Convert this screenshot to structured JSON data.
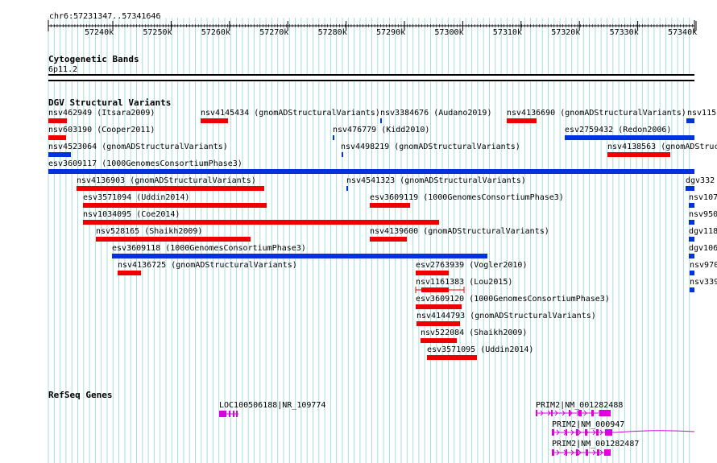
{
  "header": {
    "coords": "chr6:57231347..57341646"
  },
  "ruler": {
    "ticks": [
      "57240k",
      "57250k",
      "57260k",
      "57270k",
      "57280k",
      "57290k",
      "57300k",
      "57310k",
      "57320k",
      "57330k",
      "57340k"
    ]
  },
  "tracks": {
    "cyto": {
      "title": "Cytogenetic Bands",
      "band": "6p11.2"
    },
    "dgv": {
      "title": "DGV Structural Variants",
      "labels": [
        "nsv462949 (Itsara2009)",
        "nsv4145434 (gnomADStructuralVariants)",
        "nsv3384676 (Audano2019)",
        "nsv4136690 (gnomADStructuralVariants)",
        "nsv115",
        "nsv603190 (Cooper2011)",
        "nsv476779 (Kidd2010)",
        "esv2759432 (Redon2006)",
        "nsv4523064 (gnomADStructuralVariants)",
        "nsv4498219 (gnomADStructuralVariants)",
        "nsv4138563 (gnomADStructu",
        "esv3609117 (1000GenomesConsortiumPhase3)",
        "nsv4136903 (gnomADStructuralVariants)",
        "nsv4541323 (gnomADStructuralVariants)",
        "dgv332",
        "esv3571094 (Uddin2014)",
        "esv3609119 (1000GenomesConsortiumPhase3)",
        "nsv107",
        "nsv1034095 (Coe2014)",
        "nsv950",
        "nsv528165 (Shaikh2009)",
        "nsv4139600 (gnomADStructuralVariants)",
        "dgv118",
        "esv3609118 (1000GenomesConsortiumPhase3)",
        "dgv106",
        "nsv4136725 (gnomADStructuralVariants)",
        "esv2763939 (Vogler2010)",
        "nsv970",
        "nsv1161383 (Lou2015)",
        "nsv339",
        "esv3609120 (1000GenomesConsortiumPhase3)",
        "nsv4144793 (gnomADStructuralVariants)",
        "nsv522084 (Shaikh2009)",
        "esv3571095 (Uddin2014)"
      ]
    },
    "refseq": {
      "title": "RefSeq Genes",
      "genes": [
        "LOC100506188|NR_109774",
        "PRIM2|NM_001282488",
        "PRIM2|NM_000947",
        "PRIM2|NM_001282487"
      ]
    }
  },
  "colors": {
    "gain": "#ee0000",
    "loss": "#0033dd",
    "gene": "#dd00dd",
    "grid": "#a8dede"
  }
}
